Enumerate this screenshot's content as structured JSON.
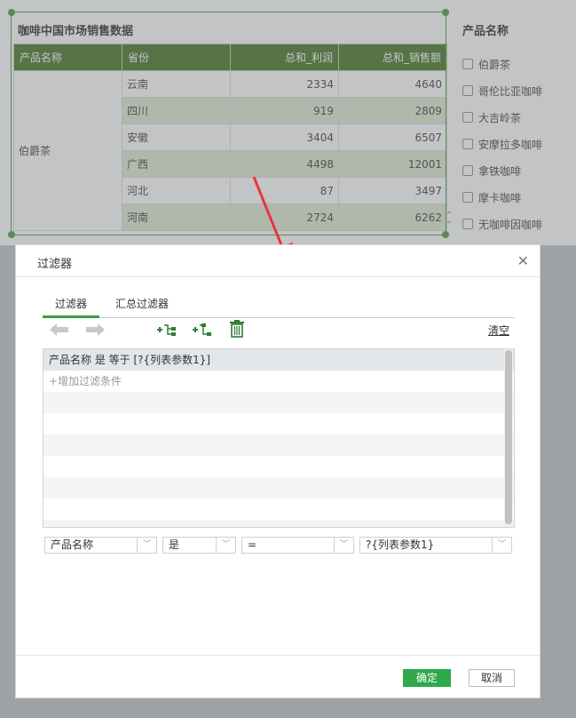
{
  "report": {
    "title": "咖啡中国市场销售数据",
    "columns": [
      "产品名称",
      "省份",
      "总和_利润",
      "总和_销售额"
    ],
    "product": "伯爵茶",
    "rows": [
      {
        "province": "云南",
        "profit": "2334",
        "sales": "4640"
      },
      {
        "province": "四川",
        "profit": "919",
        "sales": "2809"
      },
      {
        "province": "安徽",
        "profit": "3404",
        "sales": "6507"
      },
      {
        "province": "广西",
        "profit": "4498",
        "sales": "12001"
      },
      {
        "province": "河北",
        "profit": "87",
        "sales": "3497"
      },
      {
        "province": "河南",
        "profit": "2724",
        "sales": "6262"
      }
    ]
  },
  "filter_panel": {
    "title": "产品名称",
    "items": [
      "伯爵茶",
      "哥伦比亚咖啡",
      "大吉岭茶",
      "安摩拉多咖啡",
      "拿铁咖啡",
      "摩卡咖啡",
      "无咖啡因咖啡"
    ]
  },
  "dialog": {
    "title": "过滤器",
    "tabs": [
      "过滤器",
      "汇总过滤器"
    ],
    "toolbar": {
      "clear_label": "清空"
    },
    "conditions": {
      "selected": "产品名称 是 等于 [?{列表参数1}]",
      "add_label": "+增加过滤条件"
    },
    "editor": {
      "field": "产品名称",
      "mode": "是",
      "operator": "=",
      "value": "?{列表参数1}"
    },
    "buttons": {
      "ok": "确定",
      "cancel": "取消"
    }
  },
  "colors": {
    "accent": "#2ea84b",
    "header": "#3d6e18",
    "arrow": "#e8373a"
  }
}
